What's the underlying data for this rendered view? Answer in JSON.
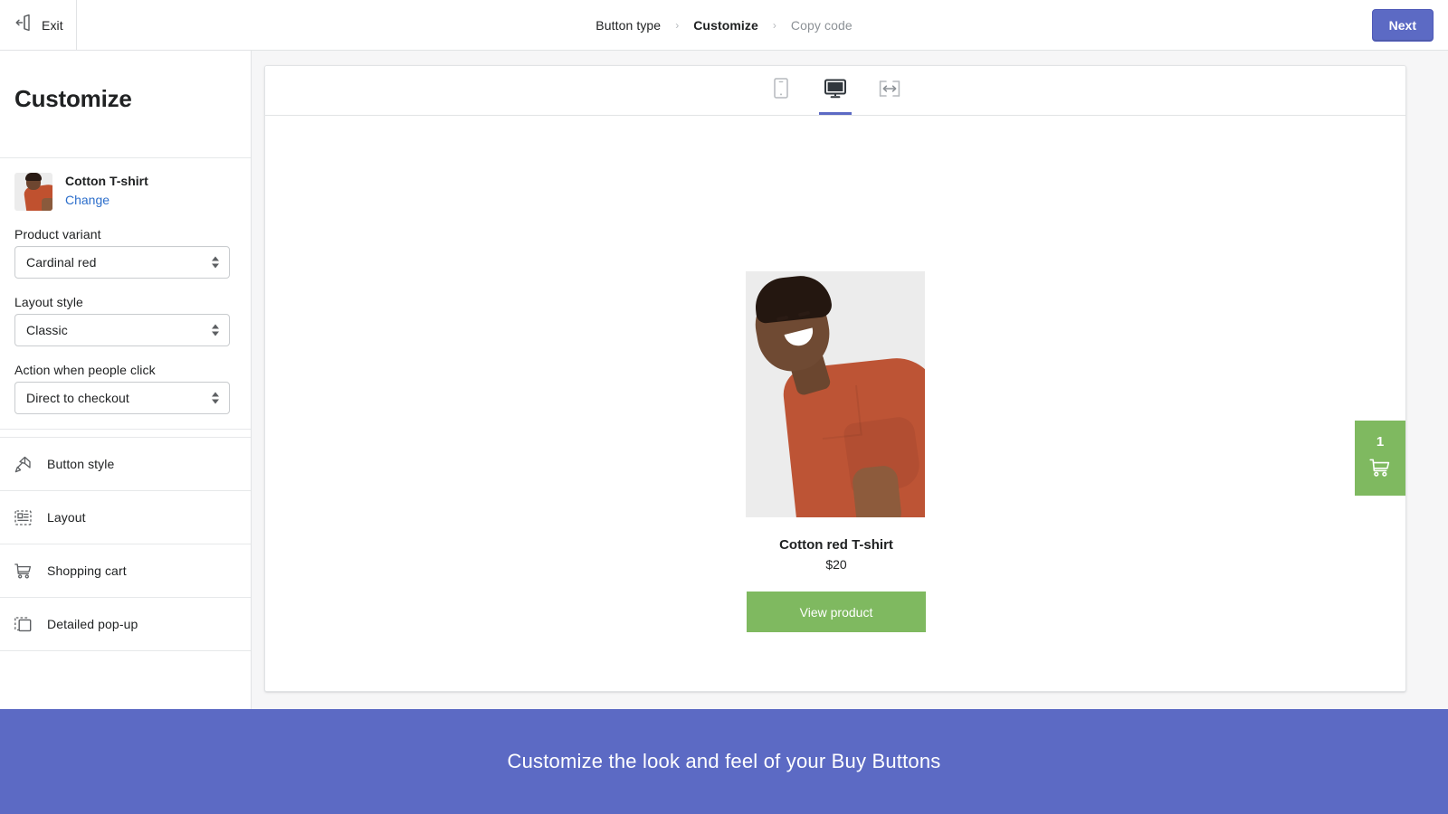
{
  "topbar": {
    "exit_label": "Exit",
    "exit_icon": "exit-door-icon",
    "breadcrumbs": [
      {
        "label": "Button type",
        "state": "done"
      },
      {
        "label": "Customize",
        "state": "active"
      },
      {
        "label": "Copy code",
        "state": "disabled"
      }
    ],
    "separator": "›",
    "next_label": "Next",
    "next_color": "#5c6ac4"
  },
  "sidebar": {
    "title": "Customize",
    "product": {
      "name": "Cotton T-shirt",
      "change_label": "Change",
      "change_color": "#2c6ecb",
      "thumbnail_icon": "product-thumbnail"
    },
    "fields": [
      {
        "label": "Product variant",
        "value": "Cardinal red"
      },
      {
        "label": "Layout style",
        "value": "Classic"
      },
      {
        "label": "Action when people click",
        "value": "Direct to checkout"
      }
    ],
    "menu": [
      {
        "label": "Button style",
        "icon": "paint-roller-icon"
      },
      {
        "label": "Layout",
        "icon": "layout-icon"
      },
      {
        "label": "Shopping cart",
        "icon": "shopping-cart-icon"
      },
      {
        "label": "Detailed pop-up",
        "icon": "popup-frame-icon"
      }
    ]
  },
  "preview": {
    "view_modes": [
      {
        "name": "mobile",
        "icon": "mobile-icon",
        "active": false
      },
      {
        "name": "desktop",
        "icon": "desktop-monitor-icon",
        "active": true
      },
      {
        "name": "full-width",
        "icon": "full-width-icon",
        "active": false
      }
    ],
    "active_indicator_color": "#5c6ac4",
    "product": {
      "title": "Cotton red T-shirt",
      "price": "$20",
      "button_label": "View product",
      "button_color": "#7fb960",
      "image_icon": "product-photo"
    },
    "cart": {
      "count": "1",
      "icon": "shopping-cart-icon",
      "color": "#7fb960"
    }
  },
  "banner": {
    "text": "Customize the look and feel of your Buy Buttons",
    "color": "#5c6ac4"
  }
}
